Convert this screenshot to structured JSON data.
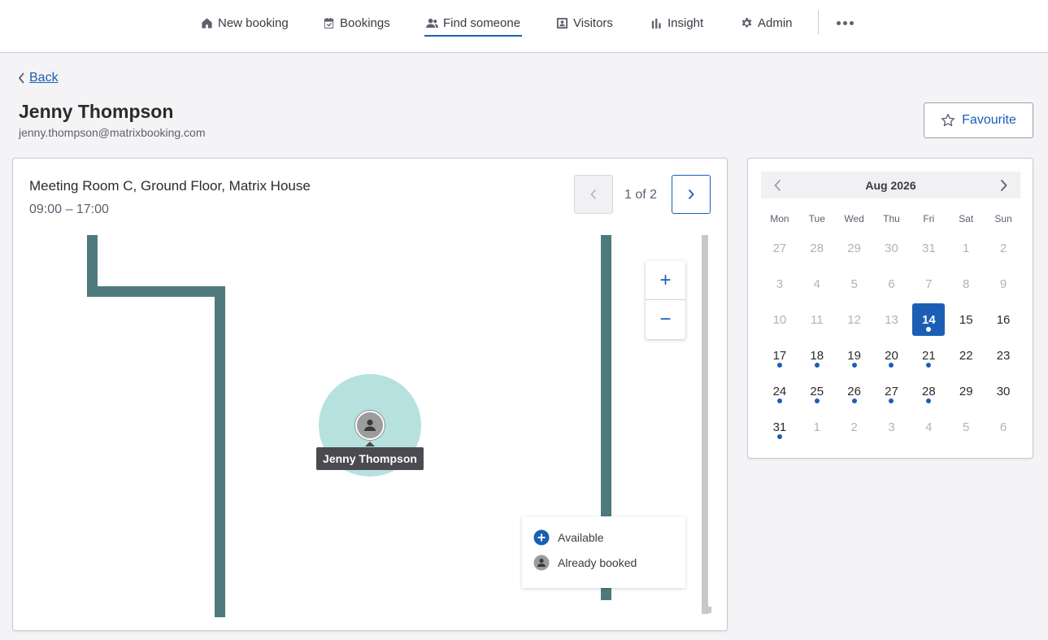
{
  "nav": {
    "items": [
      {
        "label": "New booking",
        "icon": "home-icon",
        "active": false
      },
      {
        "label": "Bookings",
        "icon": "calendar-check-icon",
        "active": false
      },
      {
        "label": "Find someone",
        "icon": "people-icon",
        "active": true
      },
      {
        "label": "Visitors",
        "icon": "visitor-badge-icon",
        "active": false
      },
      {
        "label": "Insight",
        "icon": "bar-chart-icon",
        "active": false
      },
      {
        "label": "Admin",
        "icon": "gear-icon",
        "active": false
      }
    ],
    "more_icon": "more-horizontal-icon"
  },
  "header": {
    "back_label": "Back",
    "name": "Jenny Thompson",
    "email": "jenny.thompson@matrixbooking.com",
    "favourite_label": "Favourite"
  },
  "booking": {
    "location": "Meeting Room C, Ground Floor, Matrix House",
    "time": "09:00 – 17:00",
    "pager": "1 of 2"
  },
  "map": {
    "pin_label": "Jenny Thompson",
    "zoom_in": "+",
    "zoom_out": "−",
    "legend": [
      {
        "label": "Available",
        "icon": "plus-circle-icon"
      },
      {
        "label": "Already booked",
        "icon": "person-circle-icon"
      }
    ]
  },
  "calendar": {
    "month": "Aug 2026",
    "weekdays": [
      "Mon",
      "Tue",
      "Wed",
      "Thu",
      "Fri",
      "Sat",
      "Sun"
    ],
    "weeks": [
      [
        {
          "d": "27",
          "m": true
        },
        {
          "d": "28",
          "m": true
        },
        {
          "d": "29",
          "m": true
        },
        {
          "d": "30",
          "m": true
        },
        {
          "d": "31",
          "m": true
        },
        {
          "d": "1",
          "m": true
        },
        {
          "d": "2",
          "m": true
        }
      ],
      [
        {
          "d": "3",
          "m": true
        },
        {
          "d": "4",
          "m": true
        },
        {
          "d": "5",
          "m": true
        },
        {
          "d": "6",
          "m": true
        },
        {
          "d": "7",
          "m": true
        },
        {
          "d": "8",
          "m": true
        },
        {
          "d": "9",
          "m": true
        }
      ],
      [
        {
          "d": "10",
          "m": true
        },
        {
          "d": "11",
          "m": true
        },
        {
          "d": "12",
          "m": true
        },
        {
          "d": "13",
          "m": true
        },
        {
          "d": "14",
          "sel": true,
          "dot": true
        },
        {
          "d": "15"
        },
        {
          "d": "16"
        }
      ],
      [
        {
          "d": "17",
          "dot": true
        },
        {
          "d": "18",
          "dot": true
        },
        {
          "d": "19",
          "dot": true
        },
        {
          "d": "20",
          "dot": true
        },
        {
          "d": "21",
          "dot": true
        },
        {
          "d": "22"
        },
        {
          "d": "23"
        }
      ],
      [
        {
          "d": "24",
          "dot": true
        },
        {
          "d": "25",
          "dot": true
        },
        {
          "d": "26",
          "dot": true
        },
        {
          "d": "27",
          "dot": true
        },
        {
          "d": "28",
          "dot": true
        },
        {
          "d": "29"
        },
        {
          "d": "30"
        }
      ],
      [
        {
          "d": "31",
          "dot": true
        },
        {
          "d": "1",
          "m": true
        },
        {
          "d": "2",
          "m": true
        },
        {
          "d": "3",
          "m": true
        },
        {
          "d": "4",
          "m": true
        },
        {
          "d": "5",
          "m": true
        },
        {
          "d": "6",
          "m": true
        }
      ]
    ]
  },
  "colors": {
    "accent": "#1a5fb4",
    "wall": "#4f7a7c",
    "desk_zone": "#b6e1df"
  }
}
